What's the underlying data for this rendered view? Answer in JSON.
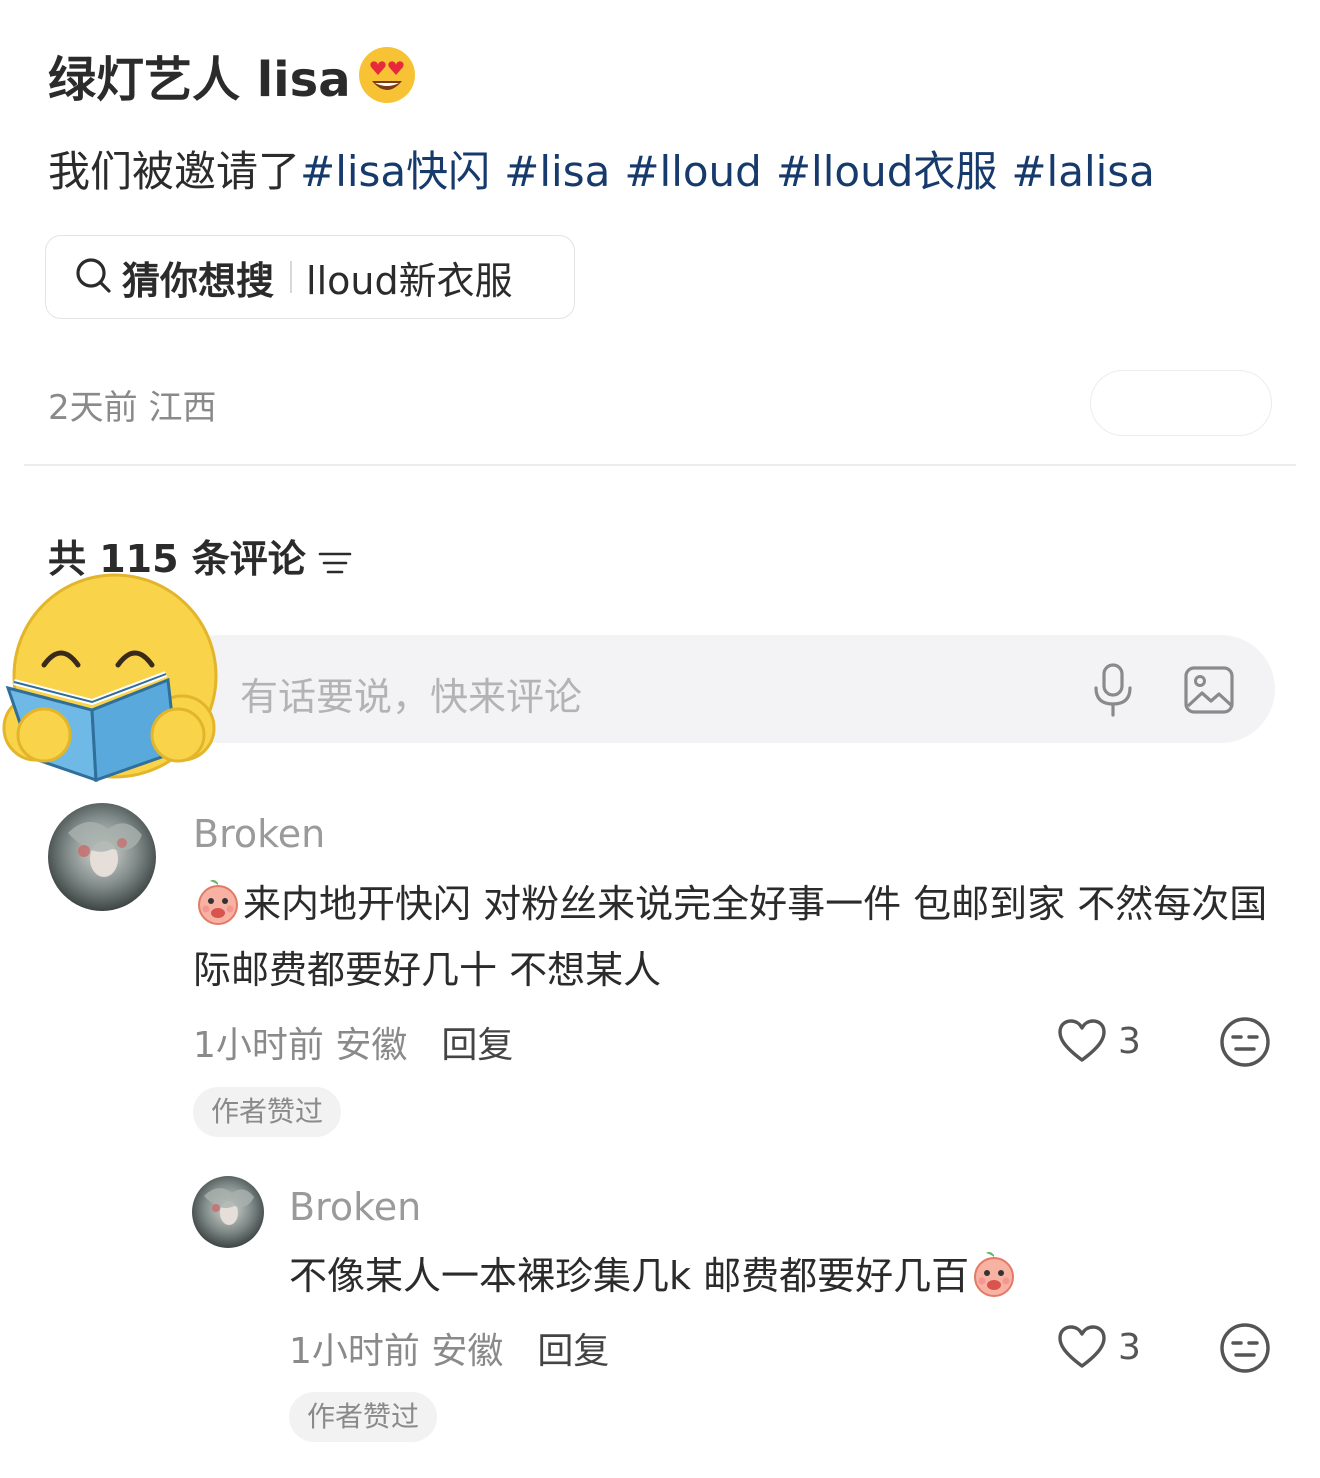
{
  "post": {
    "title": "绿灯艺人 lisa",
    "body_prefix": "我们被邀请了",
    "hashtags": [
      "#lisa快闪",
      "#lisa",
      "#lloud",
      "#lloud衣服",
      "#lalisa"
    ],
    "meta": "2天前 江西"
  },
  "search_suggest": {
    "label": "猜你想搜",
    "keyword": "lloud新衣服"
  },
  "comments_header": {
    "count_label": "共 115 条评论"
  },
  "comment_input": {
    "placeholder": "有话要说，快来评论"
  },
  "comments": [
    {
      "user": "Broken",
      "text": "来内地开快闪 对粉丝来说完全好事一件 包邮到家 不然每次国际邮费都要好几十 不想某人",
      "meta": "1小时前 安徽",
      "reply_label": "回复",
      "likes": "3",
      "badge": "作者赞过"
    },
    {
      "user": "Broken",
      "text": "不像某人一本裸珍集几k 邮费都要好几百",
      "meta": "1小时前 安徽",
      "reply_label": "回复",
      "likes": "3",
      "badge": "作者赞过"
    }
  ],
  "icons": {
    "title_emoji": "heart-eyes-emoji-icon",
    "search": "search-icon",
    "sort": "sort-lines-icon",
    "sticker": "reading-emoji-sticker",
    "mic": "microphone-icon",
    "image": "image-icon",
    "peach": "peach-emoji-icon",
    "like": "heart-outline-icon",
    "dislike": "meh-face-icon"
  },
  "colors": {
    "hashtag": "#163a6b",
    "text": "#2b2b2b",
    "muted": "#8a8a8a",
    "input_bg": "#f3f3f5"
  }
}
